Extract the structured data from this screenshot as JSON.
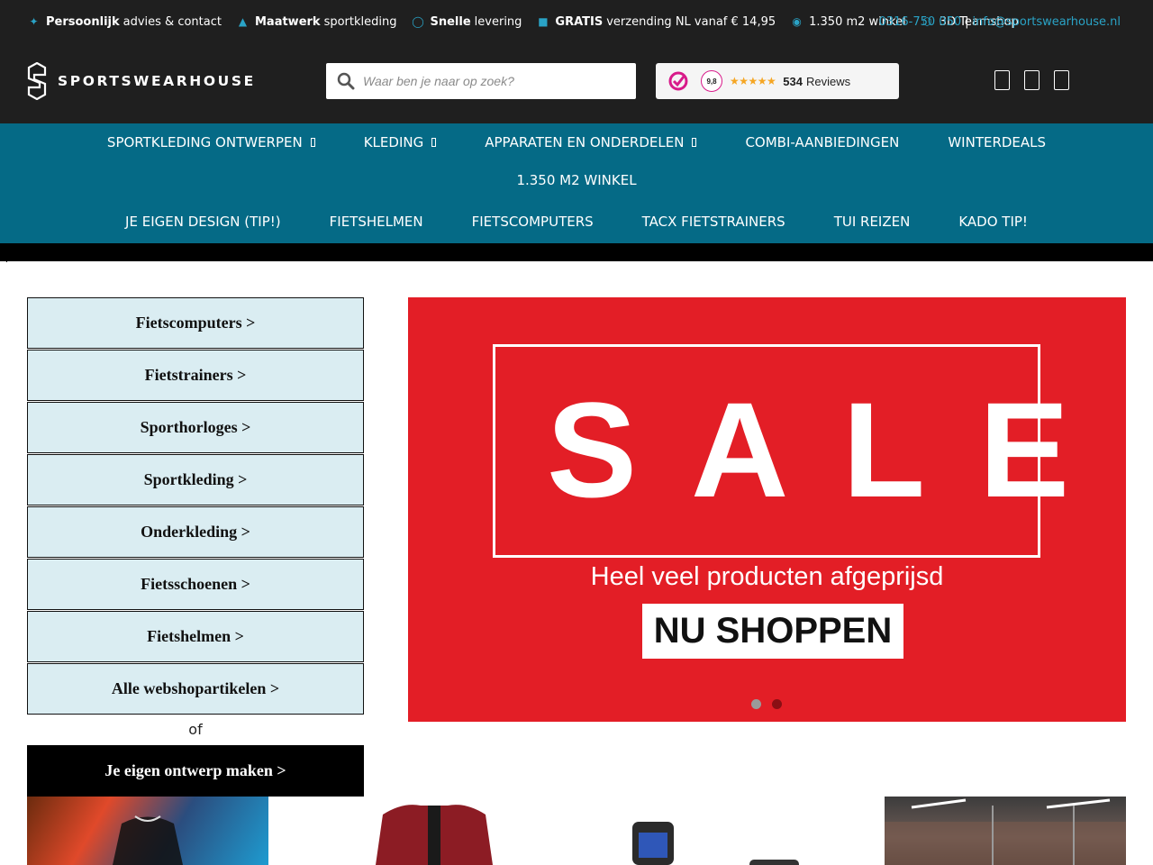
{
  "usps": [
    {
      "icon": "handshake-icon",
      "bold": "Persoonlijk",
      "text": "advies & contact"
    },
    {
      "icon": "cap-icon",
      "bold": "Maatwerk",
      "text": "sportkleding"
    },
    {
      "icon": "clock-icon",
      "bold": "Snelle",
      "text": "levering"
    },
    {
      "icon": "truck-icon",
      "bold": "GRATIS",
      "text": "verzending NL vanaf € 14,95"
    },
    {
      "icon": "location-pin-icon",
      "bold": "",
      "text": "1.350 m2 winkel"
    },
    {
      "icon": "cube-icon",
      "bold": "",
      "text": "3D Teamshop"
    }
  ],
  "contact": {
    "phone": "0316-750 050",
    "separator": "|",
    "email": "info@sportswearhouse.nl"
  },
  "logo": {
    "text": "SPORTSWEARHOUSE"
  },
  "search": {
    "placeholder": "Waar ben je naar op zoek?"
  },
  "reviews": {
    "score": "9,8",
    "stars": "★★★★★",
    "count": "534",
    "label": "Reviews"
  },
  "nav": {
    "row1": [
      {
        "label": "SPORTKLEDING ONTWERPEN",
        "has_dropdown": true
      },
      {
        "label": "KLEDING",
        "has_dropdown": true
      },
      {
        "label": "APPARATEN EN ONDERDELEN",
        "has_dropdown": true
      },
      {
        "label": "COMBI-AANBIEDINGEN",
        "has_dropdown": false
      },
      {
        "label": "WINTERDEALS",
        "has_dropdown": false
      }
    ],
    "row2": [
      {
        "label": "1.350 M2 WINKEL"
      }
    ],
    "row3": [
      {
        "label": "JE EIGEN DESIGN (TIP!)"
      },
      {
        "label": "FIETSHELMEN"
      },
      {
        "label": "FIETSCOMPUTERS"
      },
      {
        "label": "TACX FIETSTRAINERS"
      },
      {
        "label": "TUI REIZEN"
      },
      {
        "label": "KADO TIP!"
      }
    ]
  },
  "dot_mark": ".",
  "categories": [
    "Fietscomputers >",
    "Fietstrainers >",
    "Sporthorloges >",
    "Sportkleding >",
    "Onderkleding >",
    "Fietsschoenen >",
    "Fietshelmen >",
    "Alle webshopartikelen >"
  ],
  "or_text": "of",
  "design_button": "Je eigen ontwerp maken >",
  "hero": {
    "title": "SALE",
    "subtitle": "Heel veel producten afgeprijsd",
    "cta": "NU SHOPPEN",
    "background": "#e31e26",
    "slides": 2,
    "active_slide": 2
  },
  "colors": {
    "topbar": "#1f1f1f",
    "nav": "#056a86",
    "accent": "#2aa3c6",
    "category_bg": "#daedf2"
  }
}
